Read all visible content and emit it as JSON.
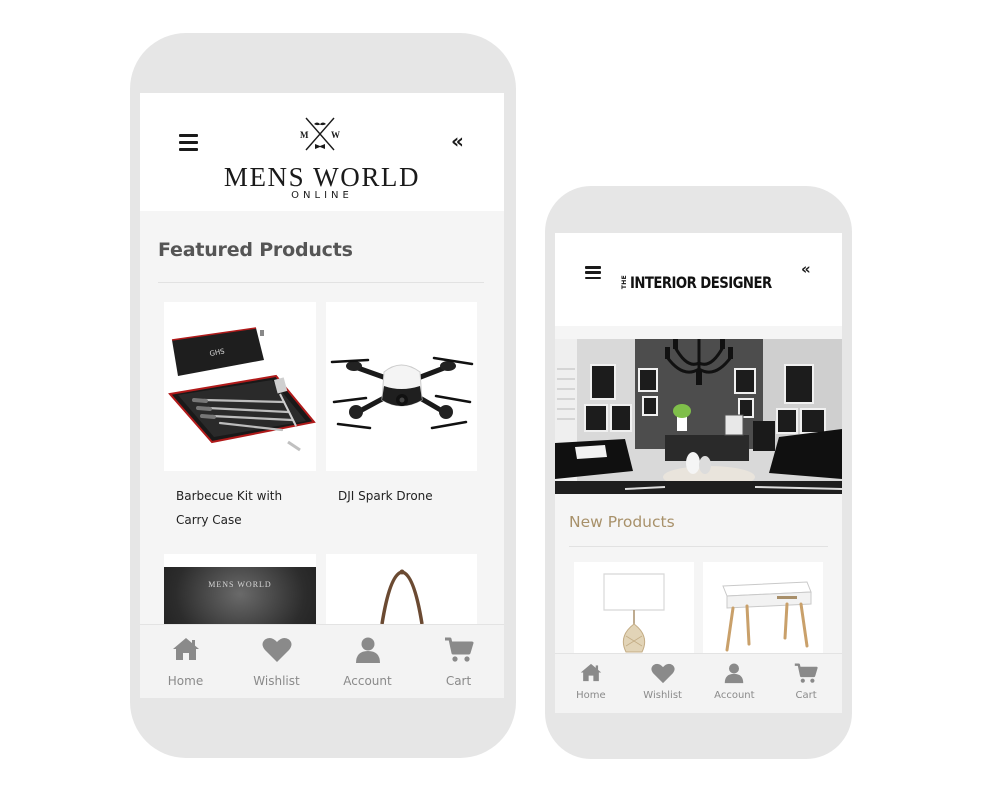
{
  "left_app": {
    "brand": {
      "mark_letters": [
        "M",
        "W"
      ],
      "title": "MENS WORLD",
      "subtitle": "ONLINE"
    },
    "header": {
      "menu_icon": "hamburger-icon",
      "collapse_icon": "double-chevron-left-icon",
      "collapse_glyph": "«"
    },
    "section_title": "Featured Products",
    "products": [
      {
        "label_line1": "Barbecue Kit with",
        "label_line2": "Carry Case",
        "image": "bbq-kit-case",
        "monogram": "GHS"
      },
      {
        "label_line1": "DJI Spark Drone",
        "label_line2": "",
        "image": "white-drone"
      },
      {
        "label_line1": "",
        "label_line2": "",
        "image": "mens-world-dark-box",
        "overlay_text": "MENS WORLD"
      },
      {
        "label_line1": "",
        "label_line2": "",
        "image": "leather-bag-handle"
      }
    ],
    "nav": [
      {
        "label": "Home",
        "icon": "home-icon"
      },
      {
        "label": "Wishlist",
        "icon": "heart-icon"
      },
      {
        "label": "Account",
        "icon": "user-icon"
      },
      {
        "label": "Cart",
        "icon": "cart-icon"
      }
    ]
  },
  "right_app": {
    "brand": {
      "the": "THE",
      "title": "INTERIOR DESIGNER"
    },
    "header": {
      "menu_icon": "hamburger-icon",
      "collapse_icon": "double-chevron-left-icon",
      "collapse_glyph": "«"
    },
    "hero_image": "living-room-chandelier",
    "section_title": "New Products",
    "products": [
      {
        "image": "table-lamp"
      },
      {
        "image": "white-desk"
      }
    ],
    "nav": [
      {
        "label": "Home",
        "icon": "home-icon"
      },
      {
        "label": "Wishlist",
        "icon": "heart-icon"
      },
      {
        "label": "Account",
        "icon": "user-icon"
      },
      {
        "label": "Cart",
        "icon": "cart-icon"
      }
    ]
  },
  "colors": {
    "device_frame": "#e6e6e6",
    "screen_bg": "#f5f5f5",
    "left_title": "#555555",
    "right_title": "#a8916a",
    "nav_icon": "#8a8a8a"
  }
}
